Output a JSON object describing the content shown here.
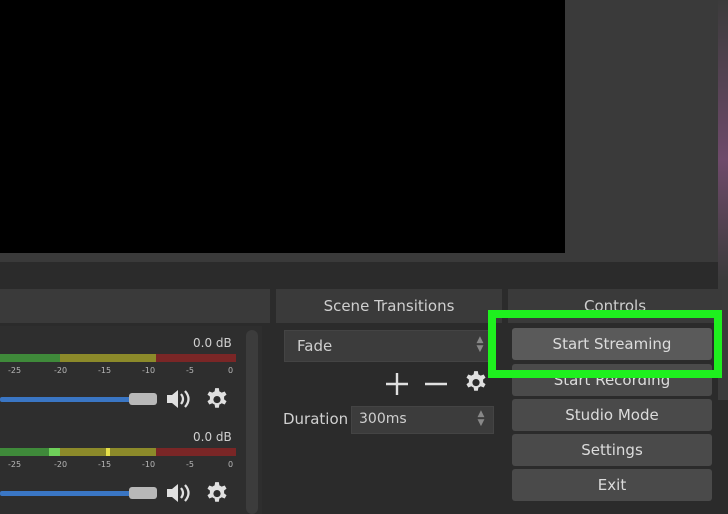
{
  "docks": {
    "transitions_title": "Scene Transitions",
    "controls_title": "Controls"
  },
  "mixer": {
    "channels": [
      {
        "db": "0.0 dB",
        "ticks": [
          "-25",
          "-20",
          "-15",
          "-10",
          "-5",
          "0"
        ]
      },
      {
        "db": "0.0 dB",
        "ticks": [
          "-25",
          "-20",
          "-15",
          "-10",
          "-5",
          "0"
        ]
      }
    ]
  },
  "transitions": {
    "selected": "Fade",
    "duration_label": "Duration",
    "duration_value": "300ms"
  },
  "controls": {
    "start_streaming": "Start Streaming",
    "start_recording": "Start Recording",
    "studio_mode": "Studio Mode",
    "settings": "Settings",
    "exit": "Exit"
  },
  "colors": {
    "highlight": "#1ef01e",
    "slider": "#3a76c4"
  }
}
